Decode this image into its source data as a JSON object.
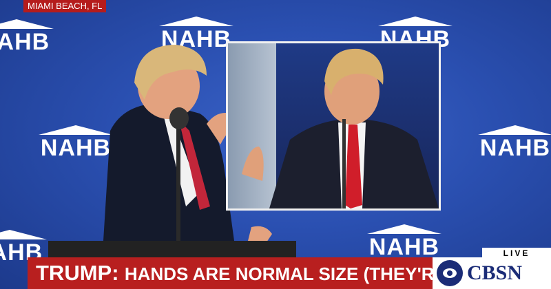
{
  "location_tag": "MIAMI BEACH, FL",
  "backdrop": {
    "logo_text": "NAHB"
  },
  "chyron": {
    "name": "TRUMP:",
    "text": "HANDS ARE NORMAL SIZE (THEY'RE NOT)"
  },
  "live_tag": "LIVE",
  "network": {
    "name": "CBSN",
    "icon": "cbs-eye-icon"
  },
  "colors": {
    "backdrop_blue": "#2a4fb0",
    "chyron_red": "#b81f1f",
    "network_blue": "#1b2c77"
  }
}
